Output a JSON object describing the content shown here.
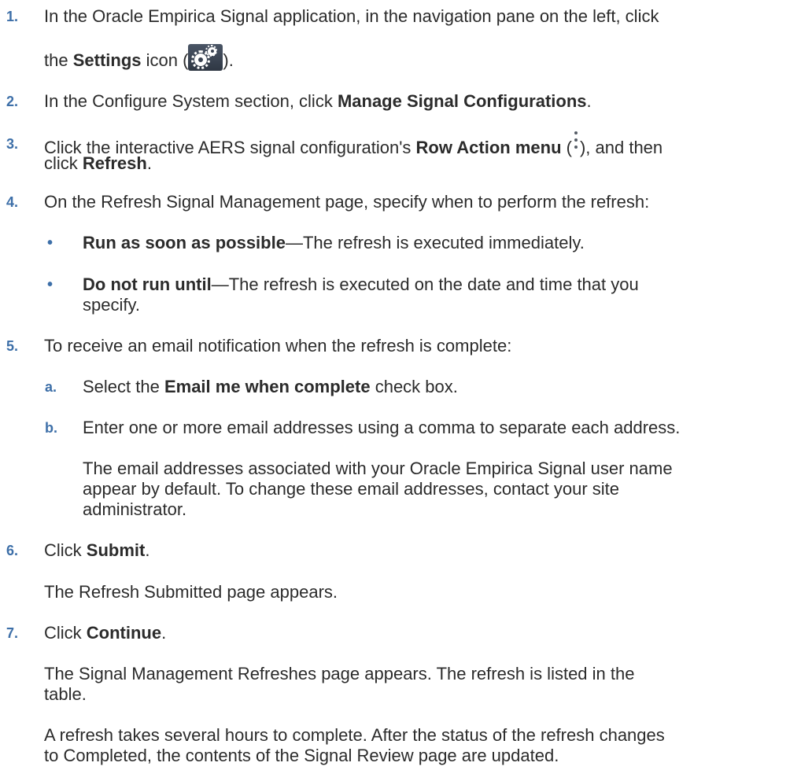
{
  "steps": [
    {
      "number": "1.",
      "line1": "In the Oracle Empirica Signal application, in the navigation pane on the left, click",
      "line2_pre": "the ",
      "line2_bold": "Settings",
      "line2_mid": " icon (",
      "line2_post": ").",
      "icon": "settings-gear-icon"
    },
    {
      "number": "2.",
      "pre": "In the Configure System section, click ",
      "bold": "Manage Signal Configurations",
      "post": "."
    },
    {
      "number": "3.",
      "pre": "Click the interactive AERS signal configuration's ",
      "bold": "Row Action menu",
      "mid": " (",
      "post": "), and then",
      "line2_pre": "click ",
      "line2_bold": "Refresh",
      "line2_post": ".",
      "icon": "kebab-menu-icon"
    },
    {
      "number": "4.",
      "text": "On the Refresh Signal Management page, specify when to perform the refresh:",
      "bullets": [
        {
          "symbol": "•",
          "bold": "Run as soon as possible",
          "text": "—The refresh is executed immediately."
        },
        {
          "symbol": "•",
          "bold": "Do not run until",
          "text": "—The refresh is executed on the date and time that you",
          "line2": "specify."
        }
      ]
    },
    {
      "number": "5.",
      "text": "To receive an email notification when the refresh is complete:",
      "substeps": [
        {
          "letter": "a.",
          "pre": "Select the ",
          "bold": "Email me when complete",
          "post": " check box."
        },
        {
          "letter": "b.",
          "text": "Enter one or more email addresses using a comma to separate each address.",
          "note_lines": [
            "The email addresses associated with your Oracle Empirica Signal user name",
            "appear by default. To change these email addresses, contact your site",
            "administrator."
          ]
        }
      ]
    },
    {
      "number": "6.",
      "pre": "Click ",
      "bold": "Submit",
      "post": ".",
      "note": "The Refresh Submitted page appears."
    },
    {
      "number": "7.",
      "pre": "Click ",
      "bold": "Continue",
      "post": ".",
      "note_lines": [
        "The Signal Management Refreshes page appears. The refresh is listed in the",
        "table."
      ],
      "note2_lines": [
        "A refresh takes several hours to complete. After the status of the refresh changes",
        "to Completed, the contents of the Signal Review page are updated."
      ]
    }
  ]
}
